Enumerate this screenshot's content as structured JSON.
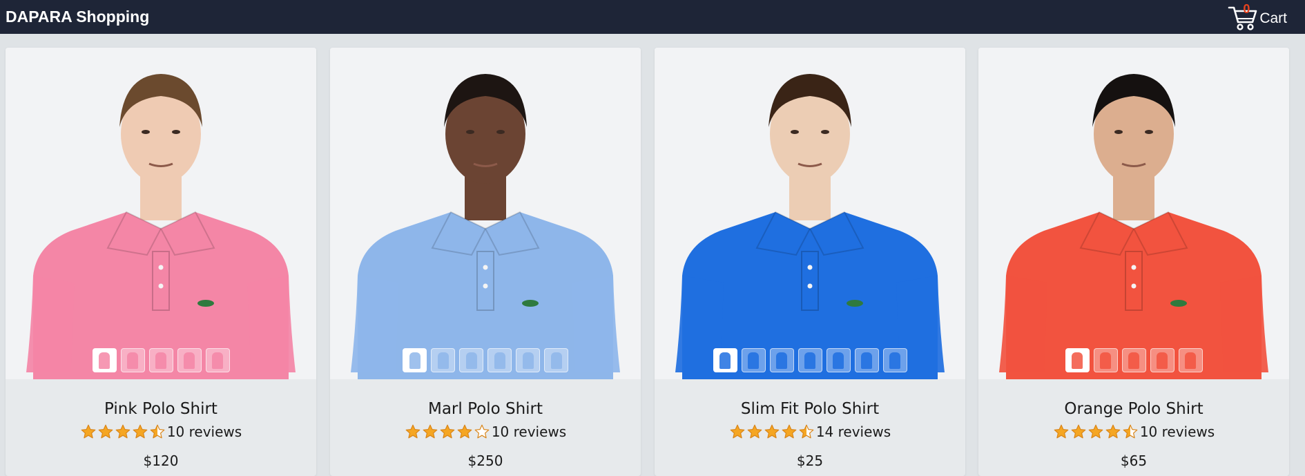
{
  "header": {
    "brand": "DAPARA Shopping",
    "cart_count": "0",
    "cart_label": "Cart",
    "cart_icon": "shopping-cart-icon"
  },
  "colors": {
    "header_bg": "#1e2537",
    "cart_count": "#e8431e",
    "star": "#f5a623"
  },
  "products": [
    {
      "name": "Pink Polo Shirt",
      "rating": 4.5,
      "reviews": "10 reviews",
      "price": "$120",
      "shirt_color": "#f486a6",
      "skin": "#efcbb3",
      "hair": "#6b4a2e",
      "thumbnail_count": 5
    },
    {
      "name": "Marl Polo Shirt",
      "rating": 4,
      "reviews": "10 reviews",
      "price": "$250",
      "shirt_color": "#8eb6ea",
      "skin": "#6b4433",
      "hair": "#1d1512",
      "thumbnail_count": 6
    },
    {
      "name": "Slim Fit Polo Shirt",
      "rating": 4.5,
      "reviews": "14 reviews",
      "price": "$25",
      "shirt_color": "#1f6fe0",
      "skin": "#eccdb4",
      "hair": "#3a2416",
      "thumbnail_count": 7
    },
    {
      "name": "Orange Polo Shirt",
      "rating": 4.5,
      "reviews": "10 reviews",
      "price": "$65",
      "shirt_color": "#f2533f",
      "skin": "#dcae8f",
      "hair": "#151110",
      "thumbnail_count": 5
    }
  ]
}
